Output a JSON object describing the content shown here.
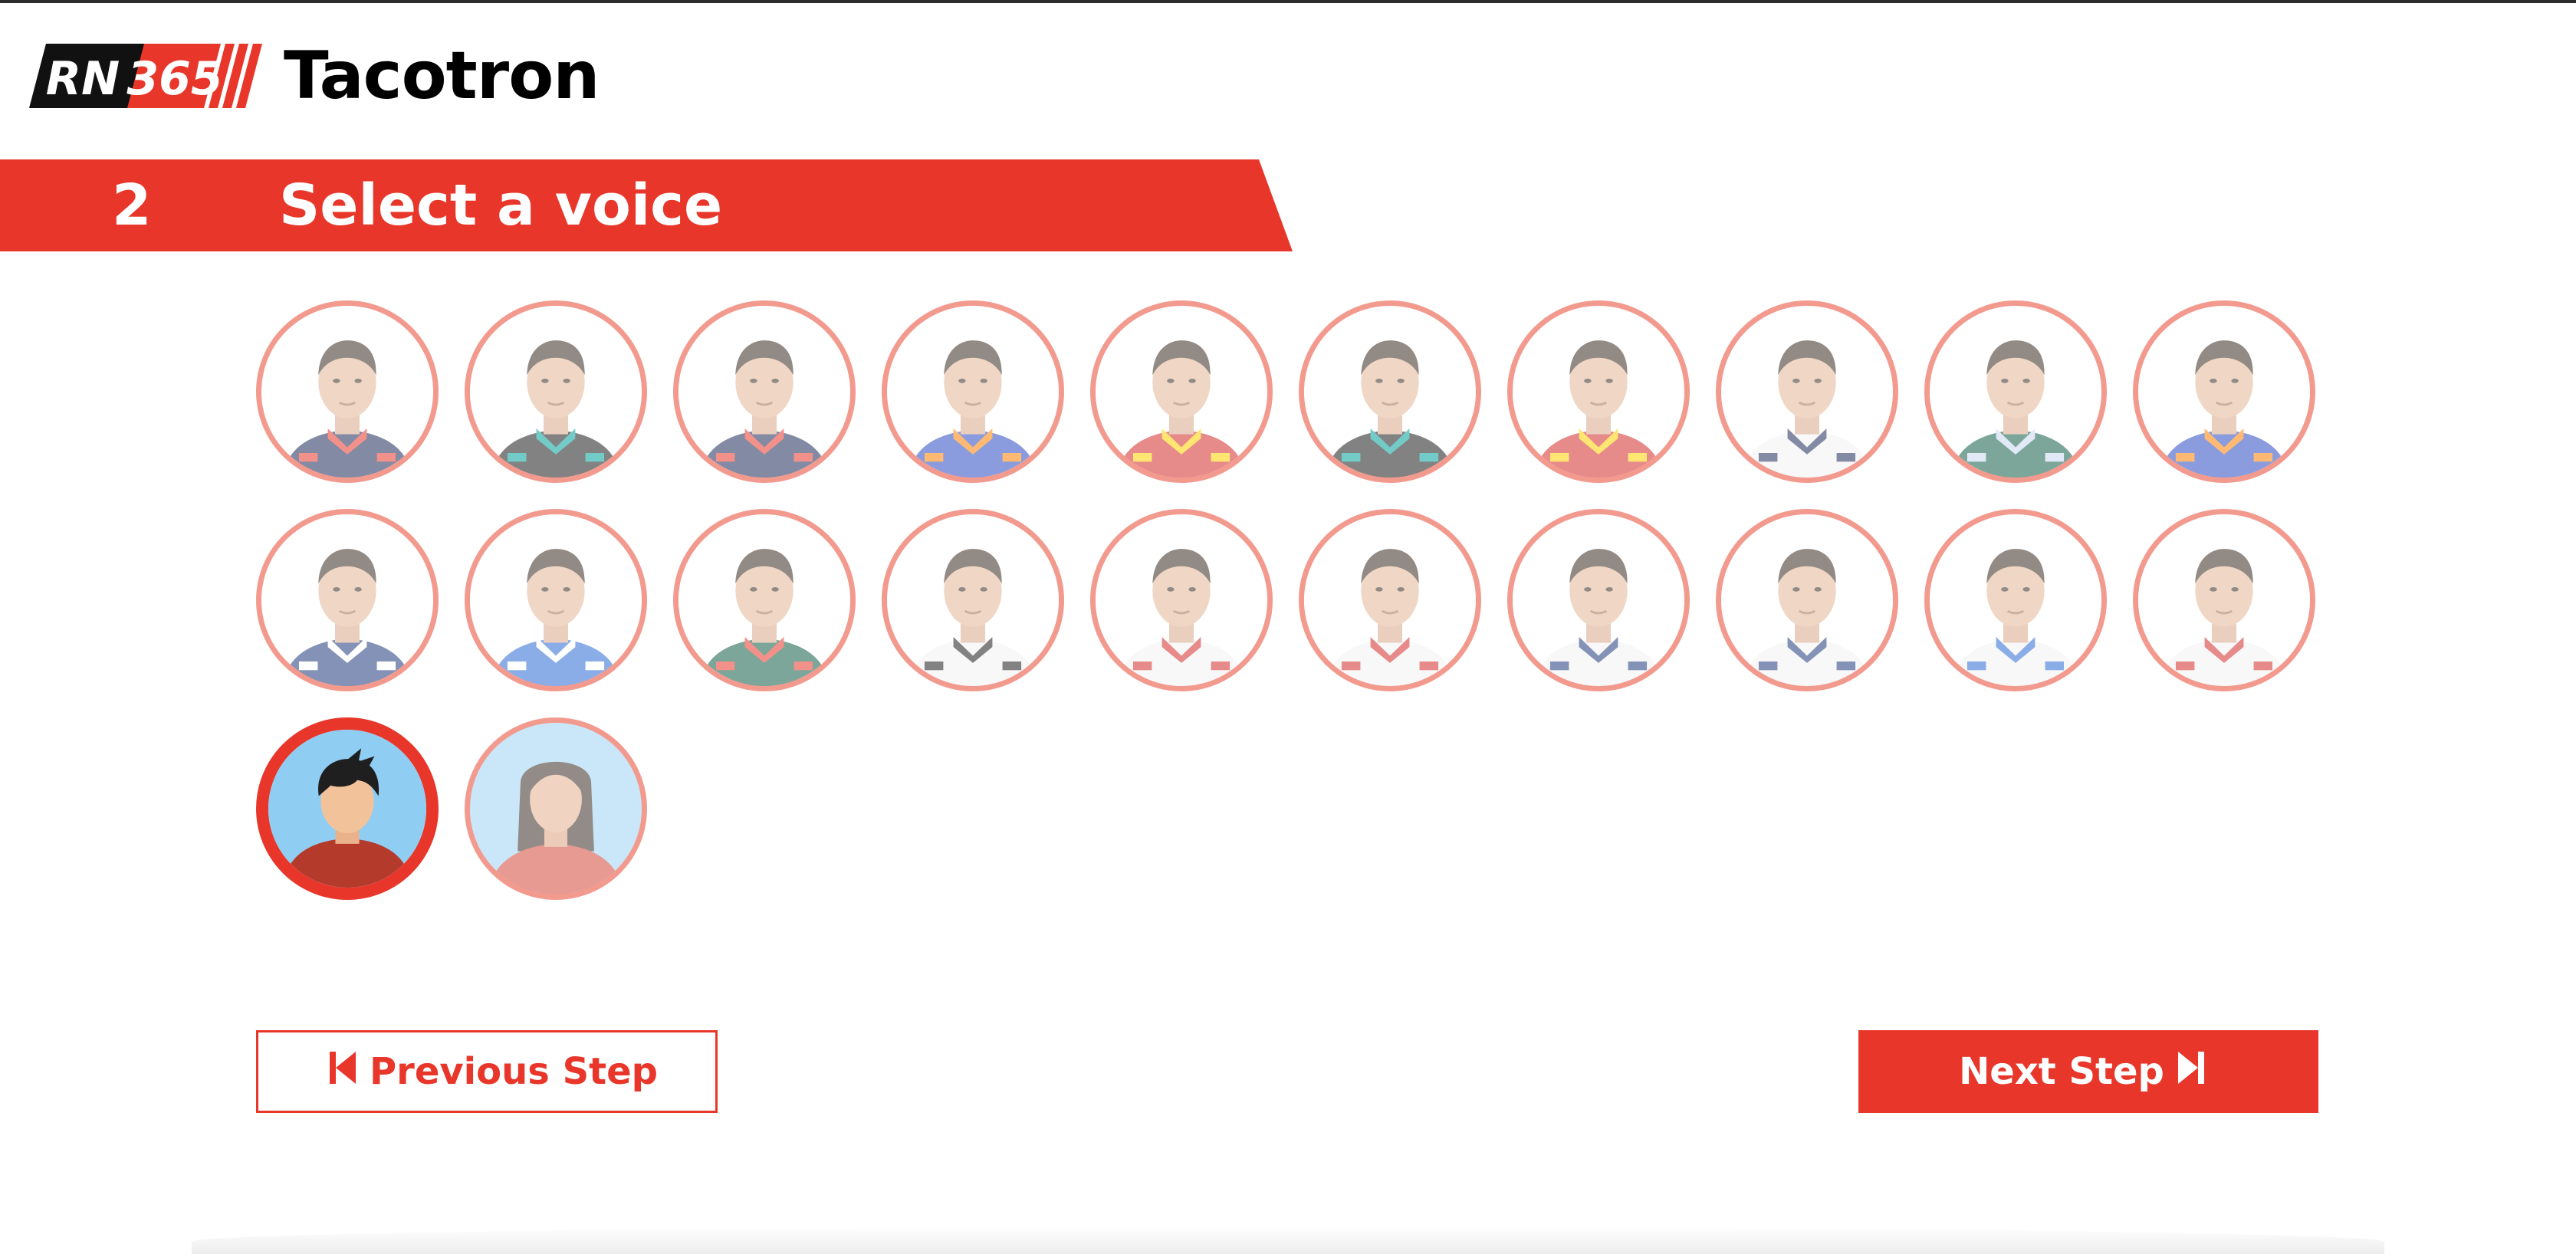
{
  "app": {
    "logo_badge_left": "RN",
    "logo_badge_right": "365",
    "title": "Tacotron",
    "brand_color": "#e8372a"
  },
  "step": {
    "number": "2",
    "title": "Select a voice"
  },
  "voices": {
    "drivers_row1": [
      {
        "icon": "driver-portrait-icon",
        "suit": "#1e2a5a",
        "accent": "#e8372a"
      },
      {
        "icon": "driver-portrait-icon",
        "suit": "#1d1d1d",
        "accent": "#00a19c"
      },
      {
        "icon": "driver-portrait-icon",
        "suit": "#1e2a5a",
        "accent": "#e8372a"
      },
      {
        "icon": "driver-portrait-icon",
        "suit": "#2b4cc2",
        "accent": "#ff8000"
      },
      {
        "icon": "driver-portrait-icon",
        "suit": "#d42a2a",
        "accent": "#ffd200"
      },
      {
        "icon": "driver-portrait-icon",
        "suit": "#1d1d1d",
        "accent": "#00a19c"
      },
      {
        "icon": "driver-portrait-icon",
        "suit": "#d42a2a",
        "accent": "#ffd200"
      },
      {
        "icon": "driver-portrait-icon",
        "suit": "#f2f2f2",
        "accent": "#1e2a5a"
      },
      {
        "icon": "driver-portrait-icon",
        "suit": "#0f5e45",
        "accent": "#c9d7f0"
      },
      {
        "icon": "driver-portrait-icon",
        "suit": "#2b4cc2",
        "accent": "#ff8000"
      }
    ],
    "drivers_row2": [
      {
        "icon": "driver-portrait-icon",
        "suit": "#1e3a7a",
        "accent": "#ffffff"
      },
      {
        "icon": "driver-portrait-icon",
        "suit": "#2a6bd4",
        "accent": "#ffffff"
      },
      {
        "icon": "driver-portrait-icon",
        "suit": "#0f5e45",
        "accent": "#e8372a"
      },
      {
        "icon": "driver-portrait-icon",
        "suit": "#f2f2f2",
        "accent": "#1d1d1d"
      },
      {
        "icon": "driver-portrait-icon",
        "suit": "#f2f2f2",
        "accent": "#d42a2a"
      },
      {
        "icon": "driver-portrait-icon",
        "suit": "#f2f2f2",
        "accent": "#d42a2a"
      },
      {
        "icon": "driver-portrait-icon",
        "suit": "#f2f2f2",
        "accent": "#1e3a7a"
      },
      {
        "icon": "driver-portrait-icon",
        "suit": "#f2f2f2",
        "accent": "#1e3a7a"
      },
      {
        "icon": "driver-portrait-icon",
        "suit": "#f2f2f2",
        "accent": "#2a6bd4"
      },
      {
        "icon": "driver-portrait-icon",
        "suit": "#f2f2f2",
        "accent": "#d42a2a"
      }
    ],
    "generic": [
      {
        "icon": "male-avatar-icon",
        "selected": true
      },
      {
        "icon": "female-avatar-icon",
        "selected": false
      }
    ]
  },
  "nav": {
    "previous_label": "Previous Step",
    "previous_icon": "skip-back-icon",
    "next_label": "Next Step",
    "next_icon": "skip-forward-icon"
  }
}
